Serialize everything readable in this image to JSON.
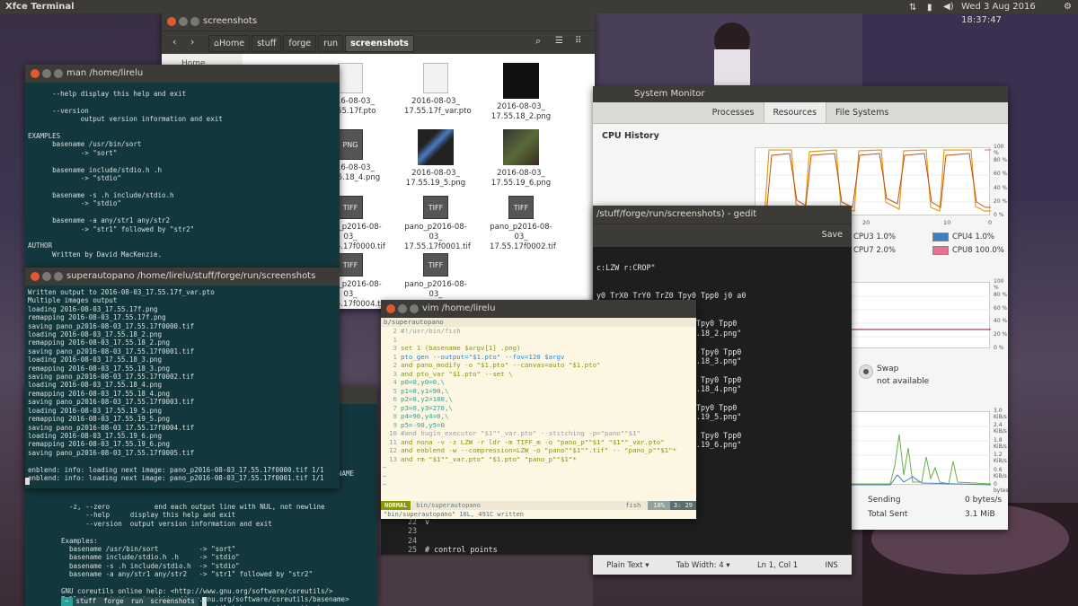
{
  "topbar": {
    "app_name": "Xfce Terminal",
    "clock": "Wed 3 Aug 2016 18:37:47"
  },
  "file_manager": {
    "title": "screenshots",
    "breadcrumb": [
      "Home",
      "stuff",
      "forge",
      "run",
      "screenshots"
    ],
    "sidebar_first": "Home",
    "files": [
      {
        "name": "2016-08-03_\n17.55.17f.pto",
        "kind": "doc"
      },
      {
        "name": "2016-08-03_\n17.55.17f_var.pto",
        "kind": "doc"
      },
      {
        "name": "2016-08-03_\n17.55.18_2.png",
        "kind": "dark"
      },
      {
        "name": "2016-08-03_\n17.55.18_4.png",
        "kind": "png"
      },
      {
        "name": "2016-08-03_\n17.55.19_5.png",
        "kind": "blue"
      },
      {
        "name": "2016-08-03_\n17.55.19_6.png",
        "kind": "green"
      },
      {
        "name": "pano_p2016-08-03_\n17.55.17f0000.tif",
        "kind": "tiff"
      },
      {
        "name": "pano_p2016-08-03_\n17.55.17f0001.tif",
        "kind": "tiff"
      },
      {
        "name": "pano_p2016-08-03_\n17.55.17f0002.tif",
        "kind": "tiff"
      },
      {
        "name": "pano_p2016-08-03_\n17.55.17f0004.tif",
        "kind": "tiff"
      },
      {
        "name": "pano_p2016-08-03_\n17.55.17f0005.tif",
        "kind": "tiff"
      }
    ],
    "png_badge": "PNG",
    "tiff_badge": "TIFF"
  },
  "man_term": {
    "title": "man  /home/lirelu",
    "text": "      --help display this help and exit\n\n      --version\n             output version information and exit\n\nEXAMPLES\n      basename /usr/bin/sort\n             -> \"sort\"\n\n      basename include/stdio.h .h\n             -> \"stdio\"\n\n      basename -s .h include/stdio.h\n             -> \"stdio\"\n\n      basename -a any/str1 any/str2\n             -> \"str1\" followed by \"str2\"\n\nAUTHOR\n      Written by David MacKenzie."
  },
  "auto_term": {
    "title": "superautopano  /home/lirelu/stuff/forge/run/screenshots",
    "text": "Written output to 2016-08-03_17.55.17f_var.pto\nMultiple images output\nloading 2016-08-03_17.55.17f.png\nremapping 2016-08-03_17.55.17f.png\nsaving pano_p2016-08-03_17.55.17f0000.tif\nloading 2016-08-03_17.55.18_2.png\nremapping 2016-08-03_17.55.18_2.png\nsaving pano_p2016-08-03_17.55.17f0001.tif\nloading 2016-08-03_17.55.18_3.png\nremapping 2016-08-03_17.55.18_3.png\nsaving pano_p2016-08-03_17.55.17f0002.tif\nloading 2016-08-03_17.55.18_4.png\nremapping 2016-08-03_17.55.18_4.png\nsaving pano_p2016-08-03_17.55.17f0003.tif\nloading 2016-08-03_17.55.19_5.png\nremapping 2016-08-03_17.55.19_5.png\nsaving pano_p2016-08-03_17.55.17f0004.tif\nloading 2016-08-03_17.55.19_6.png\nremapping 2016-08-03_17.55.19_6.png\nsaving pano_p2016-08-03_17.55.17f0005.tif\n\nenblend: info: loading next image: pano_p2016-08-03_17.55.17f0000.tif 1/1\nenblend: info: loading next image: pano_p2016-08-03_17.55.17f0001.tif 1/1"
  },
  "bottom_term": {
    "text": "  -z, --zero           end each output line with NUL, not newline\n      --help     display this help and exit\n      --version  output version information and exit\n\nExamples:\n  basename /usr/bin/sort          -> \"sort\"\n  basename include/stdio.h .h     -> \"stdio\"\n  basename -s .h include/stdio.h  -> \"stdio\"\n  basename -a any/str1 any/str2   -> \"str1\" followed by \"str2\"\n\nGNU coreutils online help: <http://www.gnu.org/software/coreutils/>\nFull documentation at: <http://www.gnu.org/software/coreutils/basename>\nor available locally via: info '(coreutils) basename invocation'",
    "prompt": [
      "~",
      "stuff",
      "forge",
      "run",
      "screenshots"
    ],
    "name_fragment": "NAME"
  },
  "vim": {
    "title": "vim  /home/lirelu",
    "tab": "b/superautopano",
    "lines": [
      {
        "n": "2",
        "t": "#!/usr/bin/fish",
        "c": "cm"
      },
      {
        "n": "1",
        "t": "",
        "c": ""
      },
      {
        "n": "3",
        "t": "set 1 (basename $argv[1] .png)",
        "c": "kw"
      },
      {
        "n": "1",
        "t": "pto_gen --output=\"$1.pto\" --fov=120 $argv",
        "c": "vr"
      },
      {
        "n": "2",
        "t": "and pano_modify -o \"$1.pto\" --canvas=auto \"$1.pto\"",
        "c": "kw"
      },
      {
        "n": "3",
        "t": "and pto_var \"$1.pto\" --set \\",
        "c": "kw"
      },
      {
        "n": "4",
        "t": "p0=0,y0=0,\\",
        "c": "st"
      },
      {
        "n": "5",
        "t": "p1=0,y1=90,\\",
        "c": "st"
      },
      {
        "n": "6",
        "t": "p2=0,y2=180,\\",
        "c": "st"
      },
      {
        "n": "7",
        "t": "p3=0,y3=270,\\",
        "c": "st"
      },
      {
        "n": "8",
        "t": "p4=90,y4=0,\\",
        "c": "st"
      },
      {
        "n": "9",
        "t": "p5=-90,y5=0",
        "c": "st"
      },
      {
        "n": "10",
        "t": "#and hugin_executor \"$1\"\"_var.pto\" --stitching -p=\"pano\"\"$1\"",
        "c": "cm"
      },
      {
        "n": "11",
        "t": "and nona -v -z LZW -r ldr -m TIFF_m -o \"pano_p\"\"$1\" \"$1\"\"_var.pto\"",
        "c": "kw"
      },
      {
        "n": "12",
        "t": "and enblend -w --compression=LZW -o \"pano\"\"$1\"\".tif\" -- \"pano_p\"\"$1\"*",
        "c": "kw"
      },
      {
        "n": "13",
        "t": "and rm \"$1\"\"_var.pto\" \"$1.pto\" \"pano_p\"\"$1\"*",
        "c": "kw"
      }
    ],
    "status_mode": "NORMAL",
    "status_file": "bin/superautopano",
    "status_ft": "fish",
    "status_pos": "18%",
    "status_cursor": "3: 29",
    "cmdline": "\"bin/superautopano\" 16L, 491C written"
  },
  "gedit": {
    "title": "/stuff/forge/run/screenshots) - gedit",
    "save_label": "Save",
    "lines": [
      "c:LZW r:CROP\"",
      "",
      "",
      "y0 TrX0 TrY0 TrZ0 Tpy0 Tpp0 j0 a0",
      "7.55.17f.png\"",
      "",
      "p0 y90 TrX0 TrY0 TrZ0 Tpy0 Tpp0",
      "Vm5 n\"2016-08-03_17.55.18_2.png\"",
      "",
      "p0 y180 TrX0 TrY0 TrZ0 Tpy0 Tpp0",
      "Vm5 n\"2016-08-03_17.55.18_3.png\"",
      "",
      "p0 y270 TrX0 TrY0 TrZ0 Tpy0 Tpp0",
      "Vm5 n\"2016-08-03_17.55.18_4.png\"",
      "",
      "p90 y0 TrX0 TrY0 TrZ0 Tpy0 Tpp0",
      "Vm5 n\"2016-08-03_17.55.19_5.png\"",
      "",
      "p-90 y0 TrX0 TrY0 TrZ0 Tpy0 Tpp0",
      "Vm5 n\"2016-08-03_17.55.19_6.png\""
    ],
    "tail_lines": [
      {
        "n": "22",
        "t": "v"
      },
      {
        "n": "23",
        "t": ""
      },
      {
        "n": "24",
        "t": ""
      },
      {
        "n": "25",
        "t": "# control points"
      }
    ],
    "status": [
      "Plain Text ▾",
      "Tab Width: 4 ▾",
      "Ln 1, Col 1",
      "INS"
    ]
  },
  "sysmon": {
    "title": "System Monitor",
    "tabs": [
      "Processes",
      "Resources",
      "File Systems"
    ],
    "cpu_history_label": "CPU History",
    "cpu_y_ticks": [
      "100 %",
      "80 %",
      "60 %",
      "40 %",
      "20 %",
      "0 %"
    ],
    "x_ticks": [
      "20",
      "10",
      "0"
    ],
    "legend": [
      {
        "label": "CPU3  1.0%",
        "color": ""
      },
      {
        "label": "CPU4  1.0%",
        "color": "#3c7fc1"
      },
      {
        "label": "CPU7  2.0%",
        "color": ""
      },
      {
        "label": "CPU8  100.0%",
        "color": "#ee6e96"
      }
    ],
    "mem_y_ticks": [
      "100 %",
      "80 %",
      "60 %",
      "40 %",
      "20 %",
      "0 %"
    ],
    "swap_label": "Swap",
    "swap_value": "not available",
    "net_y_ticks": [
      "3.0 KiB/s",
      "2.4 KiB/s",
      "1.8 KiB/s",
      "1.2 KiB/s",
      "0.6 KiB/s",
      "0 bytes/s"
    ],
    "sending_label": "Sending",
    "sending_value": "0 bytes/s",
    "total_sent_label": "Total Sent",
    "total_sent_value": "3.1 MiB"
  }
}
